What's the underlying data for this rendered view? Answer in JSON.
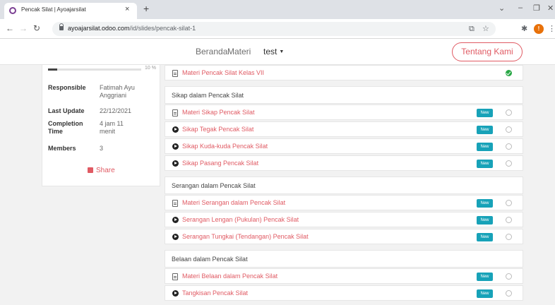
{
  "browser": {
    "tab_title": "Pencak Silat | Ayoajarsilat",
    "tab_close": "×",
    "new_tab": "+",
    "url_domain": "ayoajarsilat.odoo.com",
    "url_path": "/id/slides/pencak-silat-1",
    "profile_initial": "!",
    "win_minimize": "–",
    "win_restore": "❐",
    "win_close": "✕",
    "win_dropdown": "⌄"
  },
  "header": {
    "nav": [
      "Beranda",
      "Materi"
    ],
    "user": "test",
    "cta": "Tentang Kami"
  },
  "sidebar": {
    "progress_percent": 10,
    "progress_label": "10 %",
    "info": [
      {
        "label": "Responsible",
        "value": "Fatimah Ayu Anggriani"
      },
      {
        "label": "Last Update",
        "value": "22/12/2021"
      },
      {
        "label": "Completion Time",
        "value": "4 jam 11 menit"
      },
      {
        "label": "Members",
        "value": "3"
      }
    ],
    "share_label": "Share"
  },
  "content": {
    "rows": [
      {
        "type": "item",
        "icon": "document-icon",
        "title": "Materi Pencak Silat Kelas VII",
        "badge": "",
        "status": "done"
      },
      {
        "type": "section",
        "title": "Sikap dalam Pencak Silat"
      },
      {
        "type": "item",
        "icon": "document-icon",
        "title": "Materi Sikap Pencak Silat",
        "badge": "New",
        "status": "empty"
      },
      {
        "type": "item",
        "icon": "play-icon",
        "title": "Sikap Tegak Pencak Silat",
        "badge": "New",
        "status": "empty"
      },
      {
        "type": "item",
        "icon": "play-icon",
        "title": "Sikap Kuda-kuda Pencak Silat",
        "badge": "New",
        "status": "empty"
      },
      {
        "type": "item",
        "icon": "play-icon",
        "title": "Sikap Pasang Pencak Silat",
        "badge": "New",
        "status": "empty"
      },
      {
        "type": "section",
        "title": "Serangan dalam Pencak Silat"
      },
      {
        "type": "item",
        "icon": "document-icon",
        "title": "Materi Serangan dalam Pencak Silat",
        "badge": "New",
        "status": "empty"
      },
      {
        "type": "item",
        "icon": "play-icon",
        "title": "Serangan Lengan (Pukulan) Pencak Silat",
        "badge": "New",
        "status": "empty"
      },
      {
        "type": "item",
        "icon": "play-icon",
        "title": "Serangan Tungkai (Tendangan) Pencak Silat",
        "badge": "New",
        "status": "empty"
      },
      {
        "type": "section",
        "title": "Belaan dalam Pencak Silat"
      },
      {
        "type": "item",
        "icon": "document-icon",
        "title": "Materi Belaan dalam Pencak Silat",
        "badge": "New",
        "status": "empty"
      },
      {
        "type": "item",
        "icon": "play-icon",
        "title": "Tangkisan Pencak Silat",
        "badge": "New",
        "status": "empty"
      }
    ]
  },
  "colors": {
    "accent": "#e05a63",
    "badge": "#17a2b8",
    "done": "#28a745"
  }
}
